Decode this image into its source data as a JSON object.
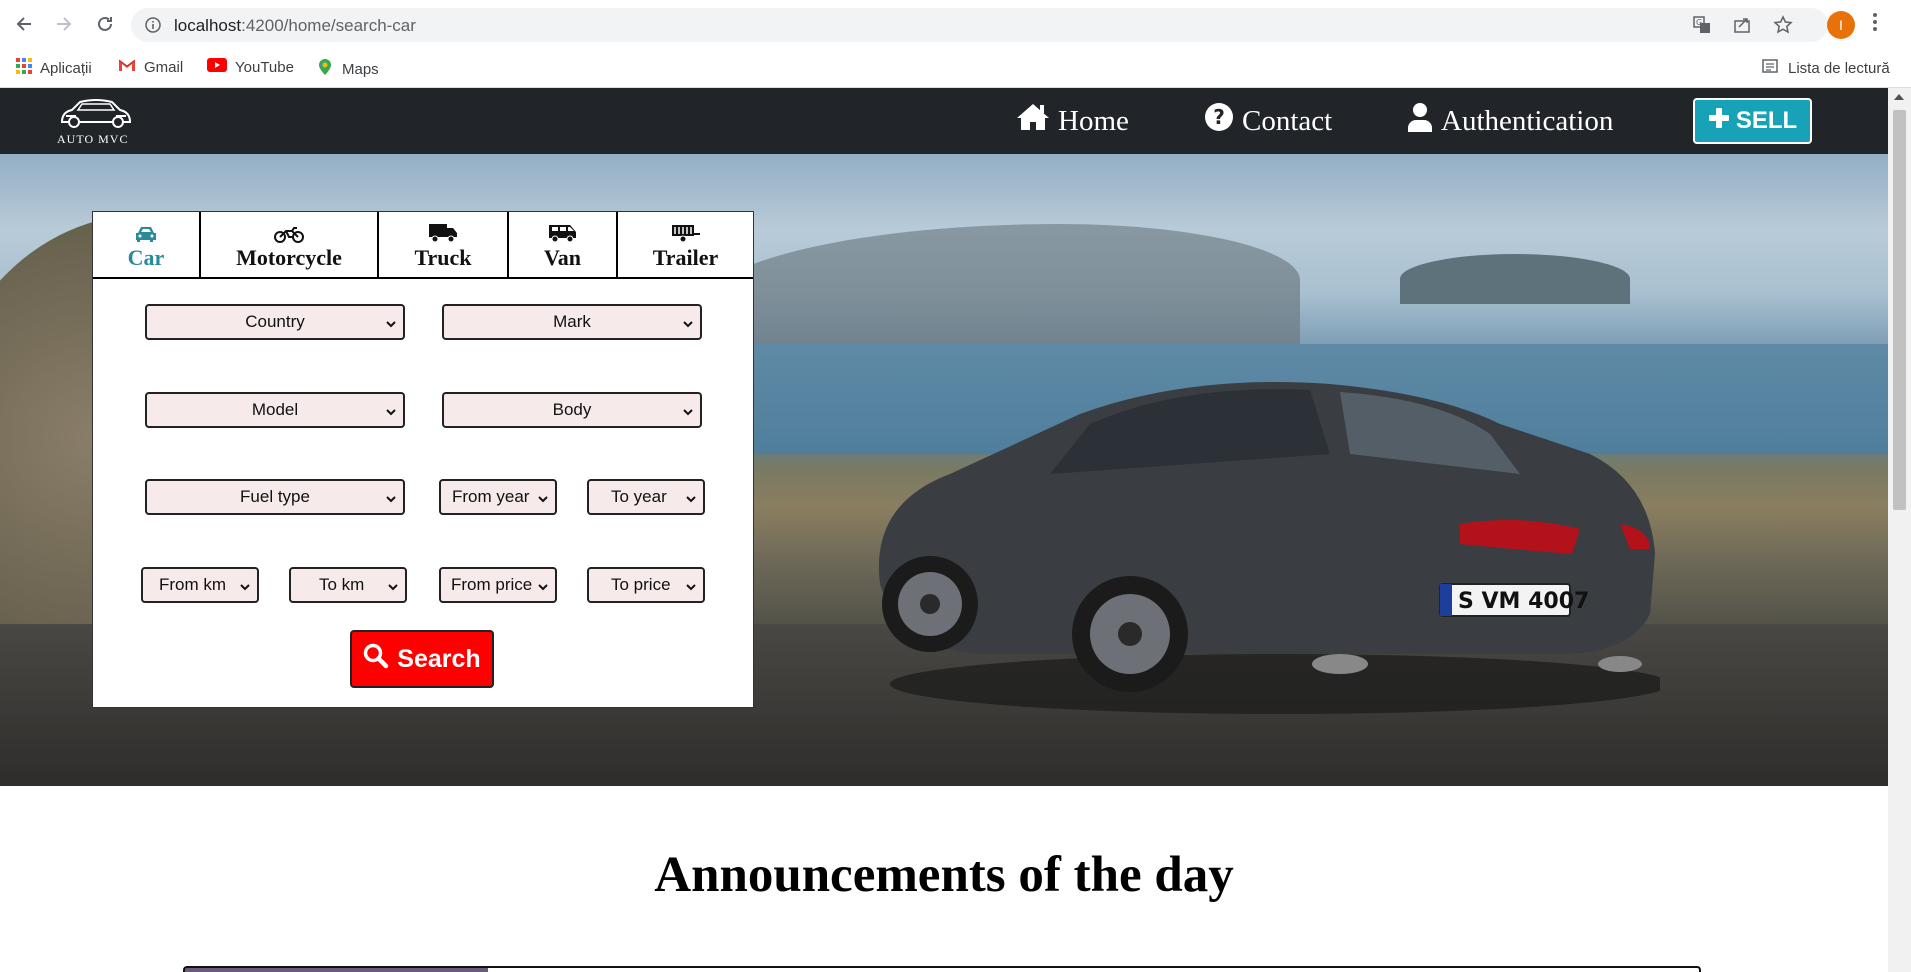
{
  "browser": {
    "url_host": "localhost",
    "url_path": ":4200/home/search-car",
    "avatar_letter": "I",
    "bookmarks": [
      {
        "label": "Aplicații",
        "icon": "apps-grid-icon"
      },
      {
        "label": "Gmail",
        "icon": "gmail-icon"
      },
      {
        "label": "YouTube",
        "icon": "youtube-icon"
      },
      {
        "label": "Maps",
        "icon": "maps-icon"
      }
    ],
    "reading_list": "Lista de lectură"
  },
  "navbar": {
    "logo_text": "AUTO MVC",
    "items": [
      {
        "label": "Home",
        "icon": "home-icon"
      },
      {
        "label": "Contact",
        "icon": "question-circle-icon"
      },
      {
        "label": "Authentication",
        "icon": "user-icon"
      }
    ],
    "sell_label": "SELL"
  },
  "search": {
    "tabs": [
      {
        "label": "Car",
        "icon": "car-icon",
        "active": true
      },
      {
        "label": "Motorcycle",
        "icon": "motorcycle-icon"
      },
      {
        "label": "Truck",
        "icon": "truck-icon"
      },
      {
        "label": "Van",
        "icon": "van-icon"
      },
      {
        "label": "Trailer",
        "icon": "trailer-icon"
      }
    ],
    "fields": {
      "country": "Country",
      "mark": "Mark",
      "model": "Model",
      "body": "Body",
      "fuel_type": "Fuel type",
      "from_year": "From year",
      "to_year": "To year",
      "from_km": "From km",
      "to_km": "To km",
      "from_price": "From price",
      "to_price": "To price"
    },
    "search_label": "Search"
  },
  "section_title": "Announcements of the day",
  "colors": {
    "navbar": "#212529",
    "sell": "#17a2b8",
    "search": "#ff0000",
    "active_tab": "#2b8a9a",
    "select_bg": "#f7eaea"
  }
}
